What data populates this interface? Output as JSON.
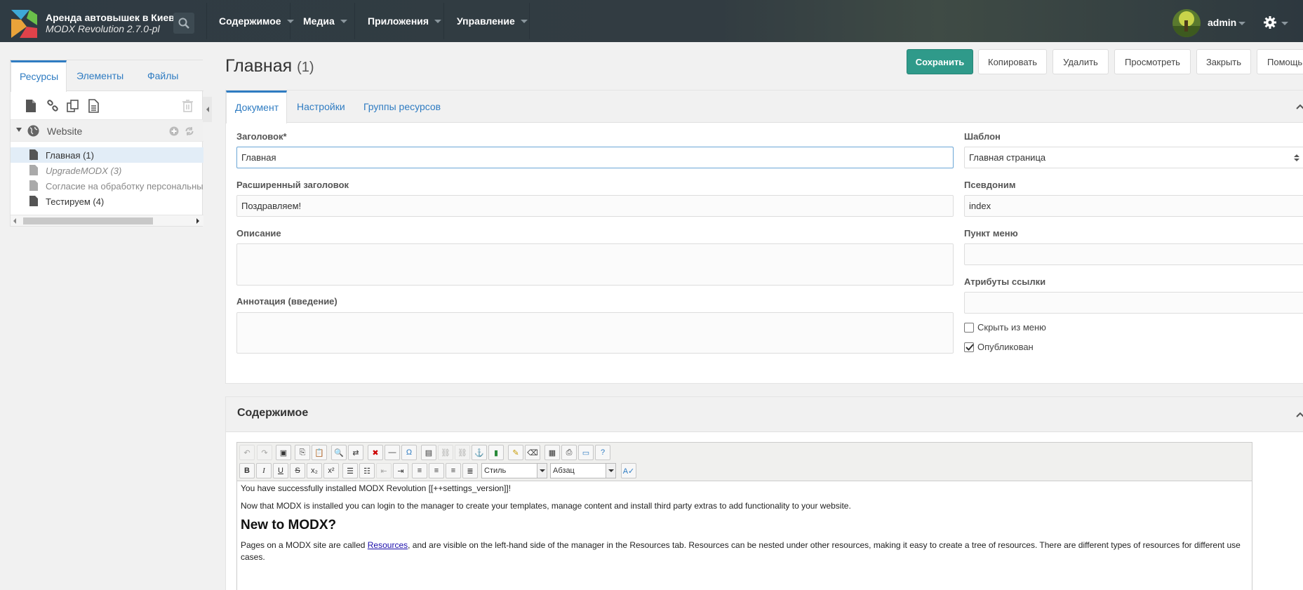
{
  "header": {
    "site_name": "Аренда автовышек в Киеве",
    "site_version": "MODX Revolution 2.7.0-pl",
    "nav": [
      "Содержимое",
      "Медиа",
      "Приложения",
      "Управление"
    ],
    "user_name": "admin"
  },
  "tree": {
    "tabs": [
      "Ресурсы",
      "Элементы",
      "Файлы"
    ],
    "root_label": "Website",
    "items": [
      {
        "label": "Главная (1)",
        "style": "selected"
      },
      {
        "label": "UpgradeMODX (3)",
        "style": "unpublished"
      },
      {
        "label": "Согласие на обработку персональных",
        "style": "hidden"
      },
      {
        "label": "Тестируем (4)",
        "style": "normal"
      }
    ]
  },
  "page": {
    "title": "Главная",
    "id_label": "(1)"
  },
  "actions": {
    "save": "Сохранить",
    "copy": "Копировать",
    "delete": "Удалить",
    "view": "Просмотреть",
    "close": "Закрыть",
    "help": "Помощь"
  },
  "doc_tabs": [
    "Документ",
    "Настройки",
    "Группы ресурсов"
  ],
  "fields": {
    "title_label": "Заголовок*",
    "title_value": "Главная",
    "longtitle_label": "Расширенный заголовок",
    "longtitle_value": "Поздравляем!",
    "description_label": "Описание",
    "introtext_label": "Аннотация (введение)",
    "template_label": "Шаблон",
    "template_value": "Главная страница",
    "alias_label": "Псевдоним",
    "alias_value": "index",
    "menutitle_label": "Пункт меню",
    "link_attr_label": "Атрибуты ссылки",
    "hidemenu_label": "Скрыть из меню",
    "hidemenu_checked": false,
    "published_label": "Опубликован",
    "published_checked": true
  },
  "content": {
    "section_title": "Содержимое",
    "style_select": "Стиль",
    "format_select": "Абзац",
    "p1": "You have successfully installed MODX Revolution [[++settings_version]]!",
    "p2": "Now that MODX is installed you can login to the manager to create your templates, manage content and install third party extras to add functionality to your website.",
    "h2": "New to MODX?",
    "p3_before": "Pages on a MODX site are called ",
    "p3_link": "Resources",
    "p3_after": ", and are visible on the left-hand side of the manager in the Resources tab. Resources can be nested under other resources, making it easy to create a tree of resources. There are different types of resources for different use cases."
  }
}
